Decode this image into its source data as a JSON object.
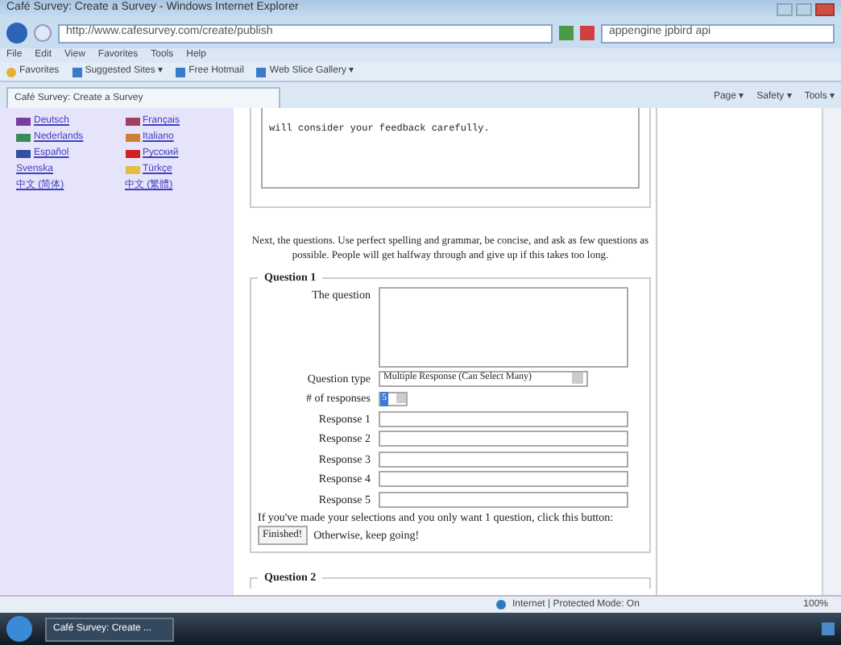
{
  "window": {
    "title": "Café Survey: Create a Survey - Windows Internet Explorer"
  },
  "address": {
    "url": "http://www.cafesurvey.com/create/publish",
    "search": "appengine jpbird api"
  },
  "menu": [
    "File",
    "Edit",
    "View",
    "Favorites",
    "Tools",
    "Help"
  ],
  "favorites": [
    {
      "label": "Favorites",
      "kind": "star"
    },
    {
      "label": "Suggested Sites ▾",
      "kind": "site"
    },
    {
      "label": "Free Hotmail",
      "kind": "site"
    },
    {
      "label": "Web Slice Gallery ▾",
      "kind": "site"
    }
  ],
  "tab": {
    "title": "Café Survey: Create a Survey"
  },
  "commands": [
    "Page ▾",
    "Safety ▾",
    "Tools ▾"
  ],
  "languages": [
    {
      "label": "Deutsch",
      "color": "#7a3d99"
    },
    {
      "label": "Français",
      "color": "#a04060"
    },
    {
      "label": "Nederlands",
      "color": "#3a8a5a"
    },
    {
      "label": "Italiano",
      "color": "#d08030"
    },
    {
      "label": "Español",
      "color": "#3050a0"
    },
    {
      "label": "Русский",
      "color": "#d02020"
    },
    {
      "label": "Svenska"
    },
    {
      "label": "Türkçe",
      "color": "#e0c040"
    },
    {
      "label": "中文 (简体)"
    },
    {
      "label": "中文 (繁體)"
    }
  ],
  "intro_box": {
    "value": "will consider your feedback carefully."
  },
  "note": "Next, the questions. Use perfect spelling and grammar, be concise, and ask as few questions as possible. People will get halfway through and give up if this takes too long.",
  "question": {
    "legend": "Question 1",
    "question_label": "The question",
    "type_label": "Question type",
    "type_value": "Multiple Response (Can Select Many)",
    "count_label": "# of responses",
    "count_value": "5",
    "responses": [
      "Response 1",
      "Response 2",
      "Response 3",
      "Response 4",
      "Response 5"
    ],
    "finish_text": "If you've made your selections and you only want 1 question, click this button:",
    "finish_button": "Finished!",
    "finish_after": "Otherwise, keep going!"
  },
  "next_legend": "Question 2",
  "status": {
    "zone": "Internet | Protected Mode: On",
    "zoom": "100%"
  },
  "taskbar": {
    "task": "Café Survey: Create ..."
  }
}
